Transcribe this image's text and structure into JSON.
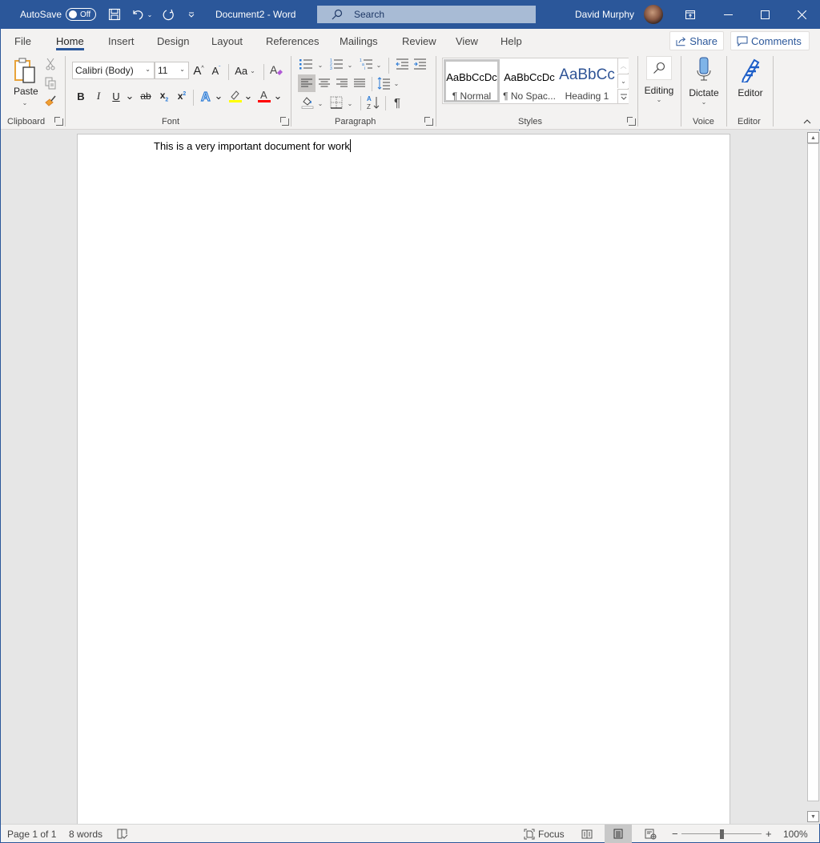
{
  "titlebar": {
    "autosave_label": "AutoSave",
    "autosave_state": "Off",
    "doc_title": "Document2  -  Word",
    "search_placeholder": "Search",
    "user_name": "David Murphy",
    "icons": [
      "save-icon",
      "undo-icon",
      "redo-icon",
      "customize-qat-icon",
      "ribbon-display-icon",
      "minimize-icon",
      "maximize-icon",
      "close-icon"
    ]
  },
  "tabs": [
    {
      "label": "File"
    },
    {
      "label": "Home",
      "active": true
    },
    {
      "label": "Insert"
    },
    {
      "label": "Design"
    },
    {
      "label": "Layout"
    },
    {
      "label": "References"
    },
    {
      "label": "Mailings"
    },
    {
      "label": "Review"
    },
    {
      "label": "View"
    },
    {
      "label": "Help"
    }
  ],
  "header_buttons": {
    "share": "Share",
    "comments": "Comments"
  },
  "ribbon": {
    "clipboard": {
      "label": "Clipboard",
      "paste": "Paste"
    },
    "font": {
      "label": "Font",
      "font_name": "Calibri (Body)",
      "font_size": "11",
      "change_case": "Aa",
      "bold": "B",
      "italic": "I",
      "underline": "U",
      "strikethrough": "ab",
      "subscript": "x",
      "superscript": "x",
      "highlight_color": "#ffff00",
      "font_color": "#ff0000"
    },
    "paragraph": {
      "label": "Paragraph",
      "pilcrow": "¶"
    },
    "styles": {
      "label": "Styles",
      "items": [
        {
          "sample": "AaBbCcDc",
          "name": "¶ Normal",
          "selected": true
        },
        {
          "sample": "AaBbCcDc",
          "name": "¶ No Spac..."
        },
        {
          "sample": "AaBbCc",
          "name": "Heading 1"
        }
      ]
    },
    "editing": {
      "label": "Editing"
    },
    "voice": {
      "label": "Voice",
      "dictate": "Dictate"
    },
    "editor": {
      "label": "Editor",
      "button": "Editor"
    }
  },
  "document": {
    "text": "This is a very important document for work"
  },
  "statusbar": {
    "page": "Page 1 of 1",
    "words": "8 words",
    "focus": "Focus",
    "zoom_minus": "−",
    "zoom_plus": "+",
    "zoom_level": "100%",
    "zoom_percent": 100
  },
  "colors": {
    "accent": "#2b579a",
    "ribbon_bg": "#f3f2f1",
    "canvas_bg": "#e6e6e6"
  }
}
